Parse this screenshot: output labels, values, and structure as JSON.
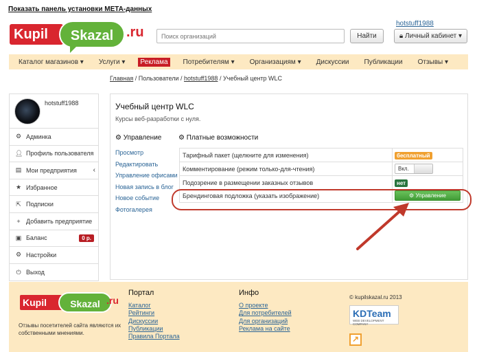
{
  "top_link": "Показать панель установки META-данных",
  "logo": {
    "kupil": "Kupil",
    "skazal": "Skazal",
    "ru": ".ru"
  },
  "search": {
    "placeholder": "Поиск организаций",
    "button": "Найти"
  },
  "user": {
    "username": "hotstuff1988",
    "cabinet": "Личный кабинет"
  },
  "nav": [
    {
      "label": "Каталог магазинов",
      "dropdown": true
    },
    {
      "label": "Услуги",
      "dropdown": true
    },
    {
      "label": "Реклама",
      "dropdown": false
    },
    {
      "label": "Потребителям",
      "dropdown": true
    },
    {
      "label": "Организациям",
      "dropdown": true
    },
    {
      "label": "Дискуссии",
      "dropdown": false
    },
    {
      "label": "Публикации",
      "dropdown": false
    },
    {
      "label": "Отзывы",
      "dropdown": true
    }
  ],
  "breadcrumb": {
    "home": "Главная",
    "users": "Пользователи",
    "user": "hotstuff1988",
    "current": "Учебный центр WLC",
    "sep": " / "
  },
  "sidebar": {
    "profile_name": "hotstuff1988",
    "items": [
      {
        "label": "Админка",
        "icon": "gear-icon"
      },
      {
        "label": "Профиль пользователя",
        "icon": "user-icon"
      },
      {
        "label": "Мои предприятия",
        "icon": "list-icon"
      },
      {
        "label": "Избранное",
        "icon": "star-icon"
      },
      {
        "label": "Подписки",
        "icon": "external-link-icon"
      },
      {
        "label": "Добавить предприятие",
        "icon": "plus-icon"
      },
      {
        "label": "Баланс",
        "icon": "wallet-icon"
      },
      {
        "label": "Настройки",
        "icon": "cogs-icon"
      },
      {
        "label": "Выход",
        "icon": "logout-icon"
      }
    ],
    "balance_value": "0 р."
  },
  "main": {
    "title": "Учебный центр WLC",
    "subtitle": "Курсы веб-разработки с нуля.",
    "manage_title": "Управление",
    "manage_links": [
      "Просмотр",
      "Редактировать",
      "Управление офисами",
      "Новая запись в блог",
      "Новое событие",
      "Фотогалерея"
    ],
    "paid_title": "Платные возможности",
    "paid_rows": [
      {
        "label": "Тарифный пакет (щелкните для изменения)",
        "value": "бесплатный"
      },
      {
        "label": "Комментирование (режим только-для-чтения)",
        "value": "Вкл."
      },
      {
        "label": "Подозрение в размещении заказных отзывов",
        "value": "нет"
      },
      {
        "label": "Брендинговая подложка (указать изображение)",
        "value": "Управление"
      }
    ]
  },
  "footer": {
    "note": "Отзывы посетителей сайта являются их собственными мнениями.",
    "portal_title": "Портал",
    "portal_links": [
      "Каталог",
      "Рейтинги",
      "Дискуссии",
      "Публикации",
      "Правила Портала"
    ],
    "info_title": "Инфо",
    "info_links": [
      "О проекте",
      "Для потребителей",
      "Для организаций",
      "Реклама на сайте"
    ],
    "copyright": "© kupilskazal.ru 2013",
    "kdteam": "KDTeam",
    "kdteam_sub": "WEB DEVELOPMENT COMPANY"
  },
  "colors": {
    "accent_red": "#c81d25",
    "accent_green": "#63b23a",
    "nav_bg": "#fde9c2",
    "link": "#2a6496"
  }
}
